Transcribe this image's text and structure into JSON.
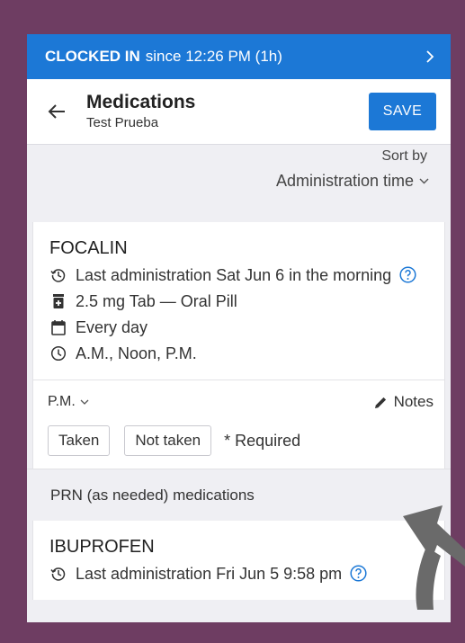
{
  "clock_bar": {
    "status": "CLOCKED IN",
    "since": "since 12:26 PM (1h)"
  },
  "header": {
    "title": "Medications",
    "subtitle": "Test Prueba",
    "save_label": "SAVE"
  },
  "sort": {
    "label": "Sort by",
    "value": "Administration time"
  },
  "medications": [
    {
      "name": "FOCALIN",
      "last_admin": "Last administration Sat Jun 6 in the morning",
      "dose": "2.5 mg Tab — Oral Pill",
      "frequency": "Every day",
      "times": "A.M., Noon, P.M.",
      "period": "P.M.",
      "notes_label": "Notes",
      "taken_label": "Taken",
      "not_taken_label": "Not taken",
      "required_label": "* Required"
    }
  ],
  "prn_section": {
    "title": "PRN (as needed) medications",
    "items": [
      {
        "name": "IBUPROFEN",
        "last_admin": "Last administration Fri Jun 5 9:58 pm"
      }
    ]
  },
  "colors": {
    "accent": "#1c78d6",
    "frame": "#6e3d62",
    "background": "#efeff3"
  }
}
